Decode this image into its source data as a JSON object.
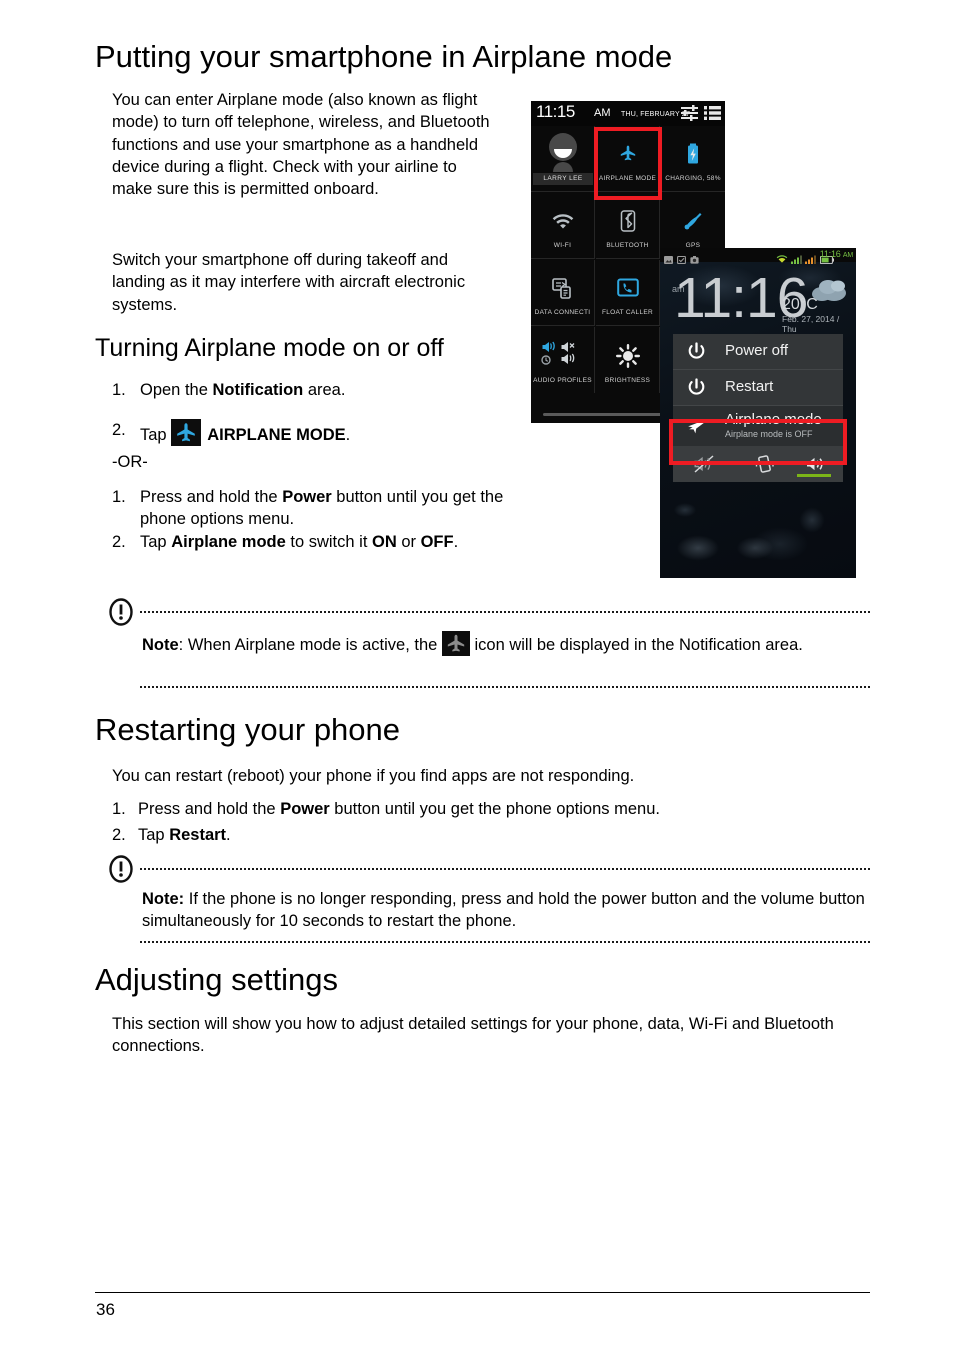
{
  "page": {
    "number": "36"
  },
  "sections": [
    {
      "heading": "Putting your smartphone in Airplane mode",
      "paragraphs": [
        "You can enter Airplane mode (also known as flight mode) to turn off telephone, wireless, and Bluetooth functions and use your smartphone as a handheld device during a flight. Check with your airline to make sure this is permitted onboard.",
        "Switch your smartphone off during takeoff and landing as it may interfere with aircraft electronic systems."
      ]
    }
  ],
  "subheading_airplane": "Turning Airplane mode on or off",
  "steps_a": {
    "item1_num": "1.",
    "item1_pre": "Open the ",
    "item1_bold": "Notification",
    "item1_post": " area.",
    "item2_num": "2.",
    "item2_pre": "Tap ",
    "item2_icon": "airplane-icon",
    "item2_bold": "AIRPLANE MODE",
    "item2_post": "."
  },
  "or_separator": "-OR-",
  "steps_b": {
    "item1_num": "1.",
    "item1_pre": "Press and hold the ",
    "item1_bold": "Power",
    "item1_post": " button until you get the phone options menu.",
    "item2_num": "2.",
    "item2_pre": "Tap ",
    "item2_bold1": "Airplane mode",
    "item2_mid": " to switch it ",
    "item2_bold2": "ON",
    "item2_mid2": " or ",
    "item2_bold3": "OFF",
    "item2_post": "."
  },
  "note_airplane": {
    "label": "Note",
    "pre": ": When Airplane mode is active, the ",
    "icon": "airplane-icon-gray",
    "post": " icon will be displayed in the Notification area."
  },
  "restart_section": {
    "heading": "Restarting your phone",
    "intro": "You can restart (reboot) your phone if you find apps are not responding.",
    "step1_num": "1.",
    "step1_pre": "Press and hold the ",
    "step1_bold": "Power",
    "step1_post": " button until you get the phone options menu.",
    "step2_num": "2.",
    "step2_pre": "Tap ",
    "step2_bold": "Restart",
    "step2_post": "."
  },
  "note_restart": {
    "label": "Note:",
    "text": " If the phone is no longer responding, press and hold the power button and the volume button simultaneously for 10 seconds to restart the phone."
  },
  "adjusting_section": {
    "heading": "Adjusting settings",
    "body": "This section will show you how to adjust detailed settings for your phone, data, Wi-Fi and Bluetooth connections."
  },
  "phone_notification_panel": {
    "status_bar": {
      "time": "11:15",
      "ampm": "AM",
      "date": "THU, FEBRUARY 27",
      "icons": [
        "sliders-icon",
        "list-icon"
      ]
    },
    "tiles": [
      {
        "label": "LARRY LEE",
        "icon": "avatar-icon",
        "highlight": false
      },
      {
        "label": "AIRPLANE MODE",
        "icon": "airplane-icon",
        "highlight": true
      },
      {
        "label": "CHARGING, 58%",
        "icon": "battery-charging-icon",
        "highlight": false
      },
      {
        "label": "WI-FI",
        "icon": "wifi-icon",
        "highlight": false
      },
      {
        "label": "BLUETOOTH",
        "icon": "bluetooth-icon",
        "highlight": false
      },
      {
        "label": "GPS",
        "icon": "gps-icon",
        "highlight": false
      },
      {
        "label": "DATA CONNECTI",
        "icon": "data-connection-icon",
        "highlight": false
      },
      {
        "label": "FLOAT CALLER",
        "icon": "float-caller-icon",
        "highlight": false
      },
      {
        "label": "",
        "icon": "",
        "highlight": false
      },
      {
        "label": "AUDIO PROFILES",
        "icon": "audio-profiles-icon",
        "highlight": false
      },
      {
        "label": "BRIGHTNESS",
        "icon": "brightness-icon",
        "highlight": false
      },
      {
        "label": "",
        "icon": "",
        "highlight": false
      }
    ]
  },
  "phone_home_screen": {
    "status_bar": {
      "time": "11:16",
      "ampm": "AM",
      "left_icons": [
        "image-icon",
        "check-icon",
        "camera-icon"
      ],
      "right_icons": [
        "wifi-icon",
        "signal-icon",
        "signal-icon",
        "battery-icon"
      ]
    },
    "widget": {
      "am": "am",
      "time": "11:16",
      "temperature": "20°C",
      "date": "Feb. 27, 2014 / Thu",
      "weather_icon": "cloud-icon"
    },
    "power_menu": {
      "items": [
        {
          "label": "Power off",
          "icon": "power-icon",
          "sub": "",
          "highlight": false
        },
        {
          "label": "Restart",
          "icon": "power-icon",
          "sub": "",
          "highlight": false
        },
        {
          "label": "Airplane mode",
          "icon": "airplane-icon",
          "sub": "Airplane mode is OFF",
          "highlight": true
        }
      ],
      "volume_icons": [
        "mute-icon",
        "vibrate-icon",
        "sound-on-icon"
      ]
    }
  },
  "colors": {
    "highlight_red": "#ee1c23",
    "accent_blue": "#2fa7e0",
    "status_green": "#76c043",
    "volume_green": "#7cb518"
  }
}
